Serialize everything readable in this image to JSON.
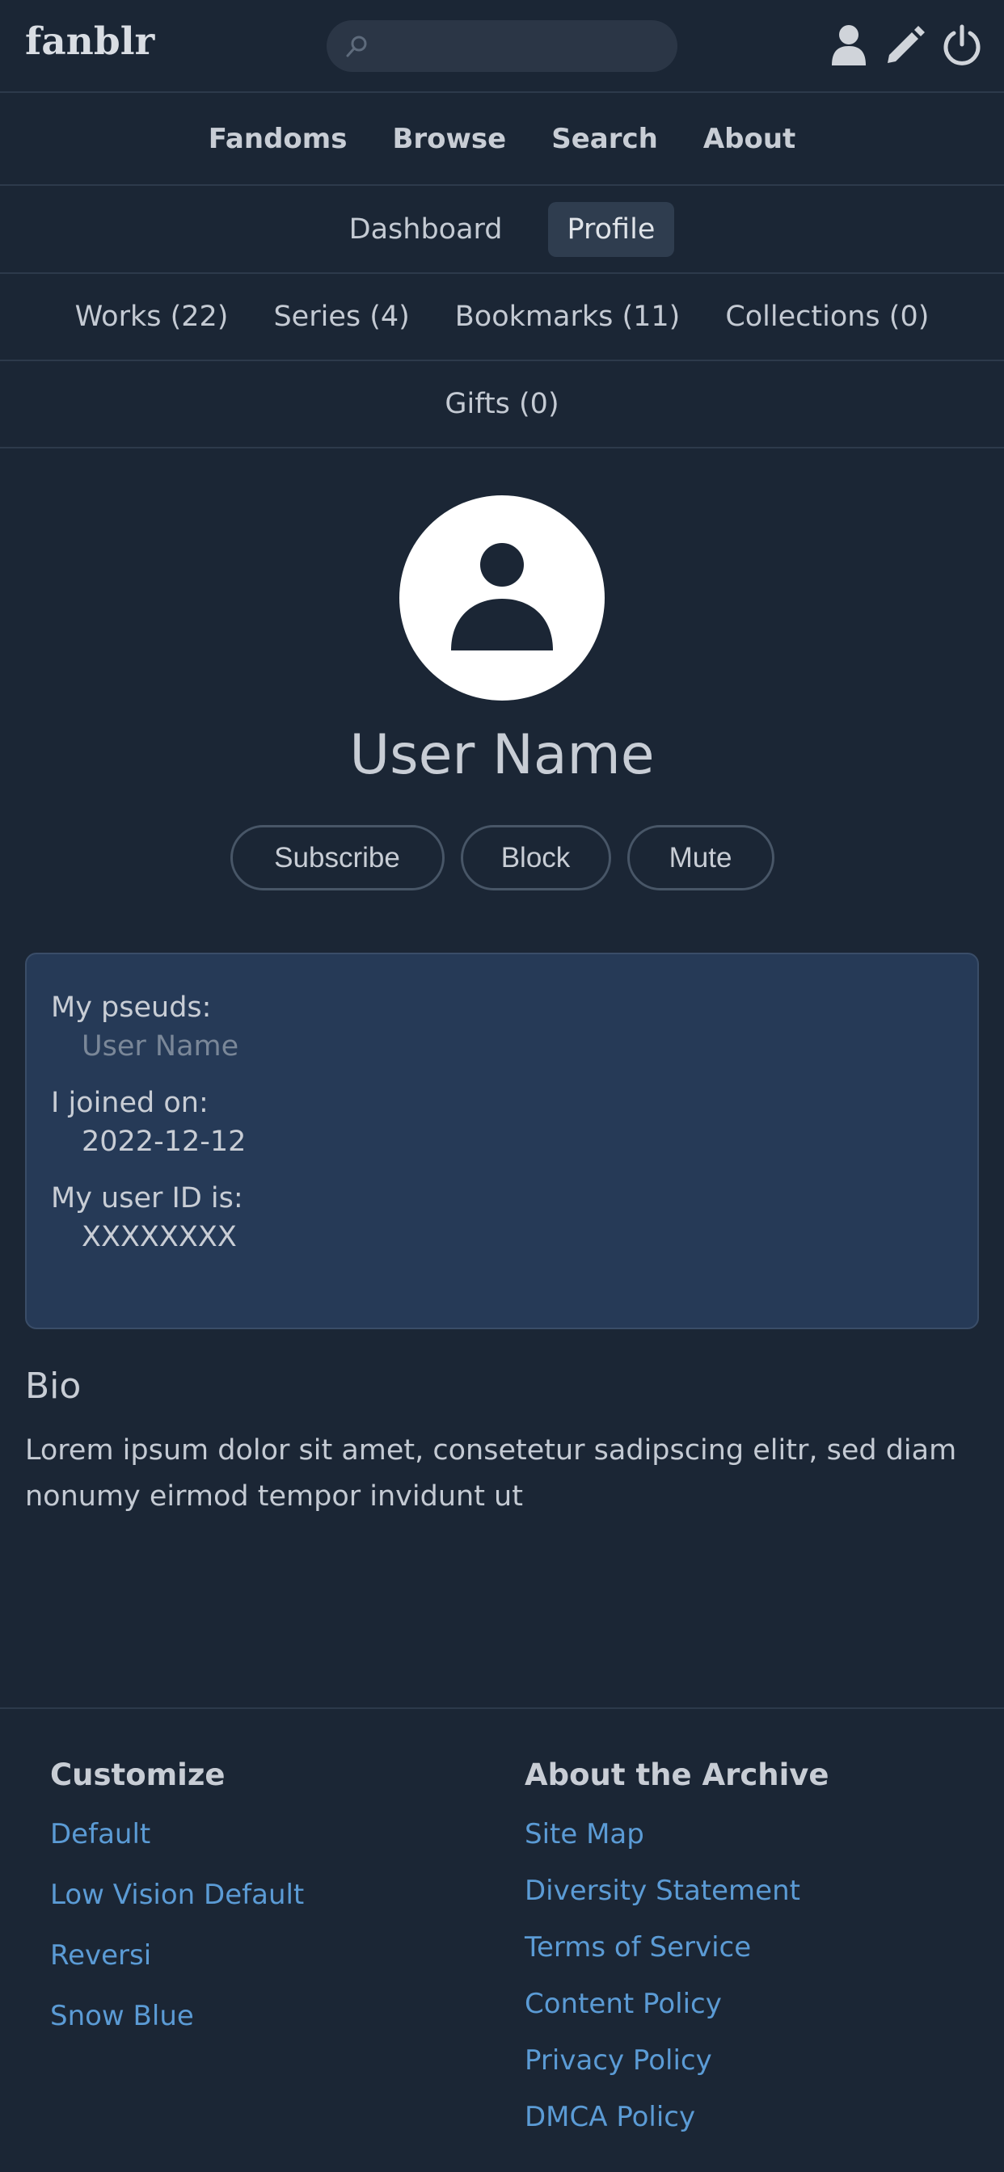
{
  "header": {
    "logo": "fanblr",
    "search_placeholder": "",
    "icons": [
      "user-icon",
      "pencil-icon",
      "power-icon"
    ]
  },
  "main_nav": [
    "Fandoms",
    "Browse",
    "Search",
    "About"
  ],
  "sub_nav": {
    "dashboard": "Dashboard",
    "profile": "Profile"
  },
  "user_tabs": [
    "Works (22)",
    "Series (4)",
    "Bookmarks (11)",
    "Collections (0)"
  ],
  "gifts_tab": "Gifts (0)",
  "profile": {
    "username": "User Name",
    "actions": [
      "Subscribe",
      "Block",
      "Mute"
    ],
    "pseuds_label": "My pseuds:",
    "pseuds_value": "User Name",
    "joined_label": "I joined on:",
    "joined_value": "2022-12-12",
    "userid_label": "My user ID is:",
    "userid_value": "XXXXXXXX"
  },
  "bio": {
    "title": "Bio",
    "text": "Lorem ipsum dolor sit amet, consetetur sadipscing elitr, sed diam nonumy eirmod tempor invidunt ut"
  },
  "footer": {
    "customize_title": "Customize",
    "customize_links": [
      "Default",
      "Low Vision Default",
      "Reversi",
      "Snow Blue"
    ],
    "archive_title": "About the Archive",
    "archive_links": [
      "Site Map",
      "Diversity Statement",
      "Terms of Service",
      "Content Policy",
      "Privacy Policy",
      "DMCA Policy"
    ]
  },
  "colors": {
    "background": "#1b2635",
    "info_panel": "#263a57",
    "link": "#5b9bd5"
  }
}
